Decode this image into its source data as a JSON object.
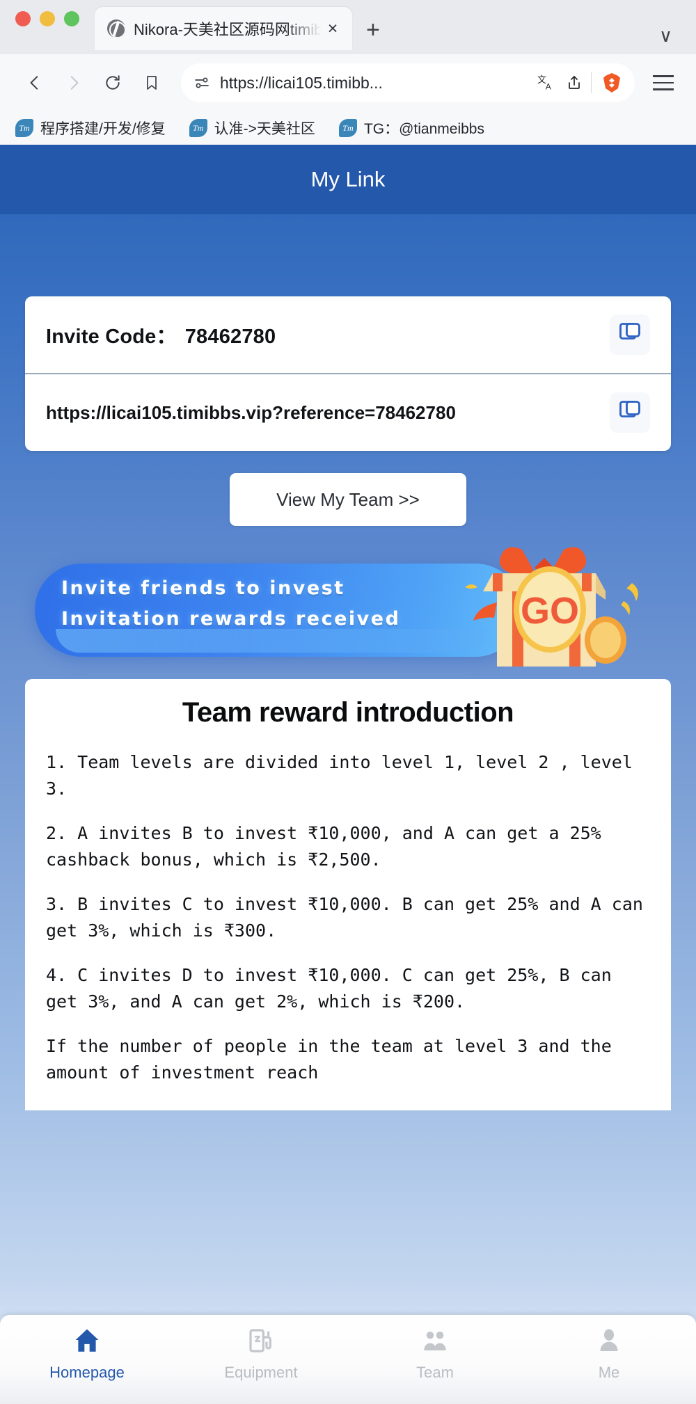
{
  "browser": {
    "tab": {
      "title": "Nikora-天美社区源码网timibbs",
      "favicon": "globe-icon",
      "close": "×",
      "new_tab": "+",
      "tab_list_chevron": "∨"
    },
    "nav": {
      "back": "back-icon",
      "forward": "forward-icon",
      "reload": "reload-icon",
      "bookmark": "bookmark-icon",
      "site_settings": "sliders-icon",
      "url": "https://licai105.timibb...",
      "translate": "translate-icon",
      "share": "share-icon",
      "shields": "brave-shields-icon",
      "menu": "hamburger-menu-icon"
    },
    "bookmarks": [
      {
        "icon": "Tm",
        "label": "程序搭建/开发/修复"
      },
      {
        "icon": "Tm",
        "label": "认准->天美社区"
      },
      {
        "icon": "Tm",
        "label": "TG：@tianmeibbs"
      }
    ]
  },
  "page": {
    "header": {
      "title": "My Link"
    },
    "invite": {
      "code_label": "Invite Code：",
      "code_value": "78462780",
      "copy_code_icon": "copy-icon",
      "url": "https://licai105.timibbs.vip?reference=78462780",
      "copy_url_icon": "copy-icon"
    },
    "team_button": "View My Team >>",
    "promo": {
      "line1": "Invite friends to invest",
      "line2": "Invitation rewards received",
      "badge": "GO",
      "illustration": "gift-box-icon"
    },
    "intro": {
      "title": "Team reward introduction",
      "paragraphs": [
        "1. Team levels are divided into level 1, level 2 , level 3.",
        "2. A invites B to invest ₹10,000, and A can get a 25% cashback bonus, which is ₹2,500.",
        "3. B invites C to invest ₹10,000. B can get 25% and A can get 3%, which is ₹300.",
        "4. C invites D to invest ₹10,000. C can get 25%, B can get 3%, and A can get 2%, which is ₹200.",
        "If the number of people in the team at level 3 and the amount of investment reach"
      ]
    },
    "bottom_nav": [
      {
        "label": "Homepage",
        "icon": "home-icon",
        "active": true
      },
      {
        "label": "Equipment",
        "icon": "equipment-icon",
        "active": false
      },
      {
        "label": "Team",
        "icon": "team-icon",
        "active": false
      },
      {
        "label": "Me",
        "icon": "person-icon",
        "active": false
      }
    ]
  },
  "colors": {
    "brand_blue": "#2458ab",
    "accent_blue": "#2e63c4",
    "promo_blue": "#2f6fe8",
    "inactive_gray": "#b9bcc1"
  }
}
